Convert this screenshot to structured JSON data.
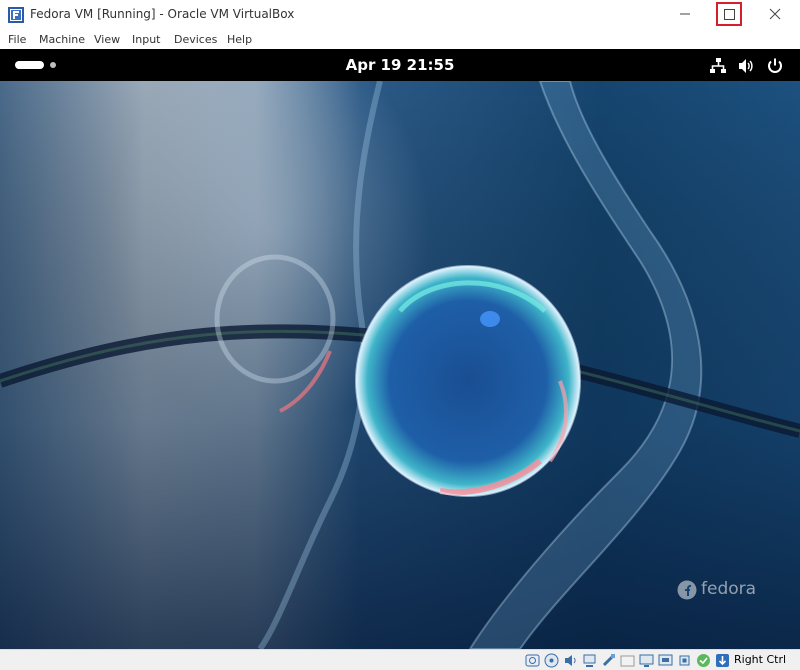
{
  "window": {
    "title": "Fedora VM [Running] - Oracle VM VirtualBox"
  },
  "menu": [
    "File",
    "Machine",
    "View",
    "Input",
    "Devices",
    "Help"
  ],
  "gnome": {
    "clock": "Apr 19  21:55"
  },
  "wallpaper": {
    "brand": "fedora"
  },
  "statusbar": {
    "host_key": "Right Ctrl",
    "icons": [
      "hard-disk-icon",
      "optical-drive-icon",
      "audio-icon",
      "network-icon",
      "usb-icon",
      "shared-folders-icon",
      "display-icon",
      "video-capture-icon",
      "cpu-icon",
      "mouse-integration-icon",
      "keyboard-icon"
    ]
  },
  "colors": {
    "highlight": "#d4202c",
    "gnome_bar": "#000000",
    "desktop": "#0d2f55"
  }
}
